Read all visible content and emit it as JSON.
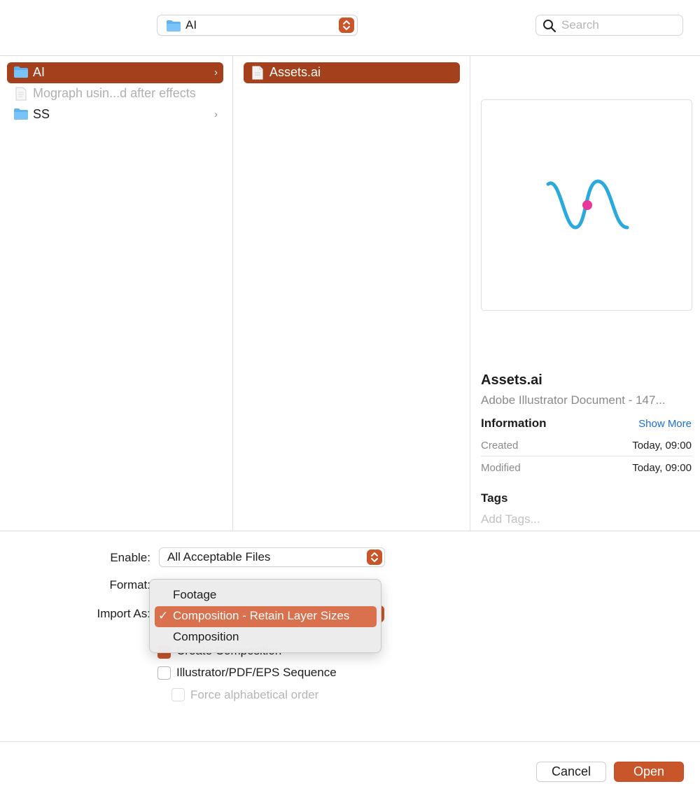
{
  "toolbar": {
    "location": "AI",
    "search_placeholder": "Search"
  },
  "sidebar": {
    "items": [
      {
        "label": "AI",
        "icon": "folder-icon",
        "selected": true,
        "has_children": true
      },
      {
        "label": "Mograph usin...d after effects",
        "icon": "document-icon",
        "disabled": true
      },
      {
        "label": "SS",
        "icon": "folder-icon",
        "has_children": true
      }
    ]
  },
  "files": {
    "items": [
      {
        "label": "Assets.ai",
        "icon": "document-icon",
        "selected": true
      }
    ]
  },
  "preview": {
    "name": "Assets.ai",
    "kind": "Adobe Illustrator Document - 147...",
    "information_heading": "Information",
    "show_more": "Show More",
    "created_label": "Created",
    "created_value": "Today, 09:00",
    "modified_label": "Modified",
    "modified_value": "Today, 09:00",
    "tags_heading": "Tags",
    "tags_placeholder": "Add Tags..."
  },
  "options": {
    "enable_label": "Enable:",
    "enable_value": "All Acceptable Files",
    "format_label": "Format:",
    "import_as_label": "Import As:",
    "create_composition": "Create Composition",
    "sequence": "Illustrator/PDF/EPS Sequence",
    "force_alpha": "Force alphabetical order"
  },
  "menu": {
    "items": [
      {
        "label": "Footage"
      },
      {
        "label": "Composition - Retain Layer Sizes",
        "checked": true
      },
      {
        "label": "Composition"
      }
    ],
    "check_glyph": "✓"
  },
  "buttons": {
    "cancel": "Cancel",
    "open": "Open"
  },
  "colors": {
    "accent": "#c9552a",
    "selection": "#a4401b",
    "menu_highlight": "#d9714f",
    "link": "#1a6fd6"
  }
}
